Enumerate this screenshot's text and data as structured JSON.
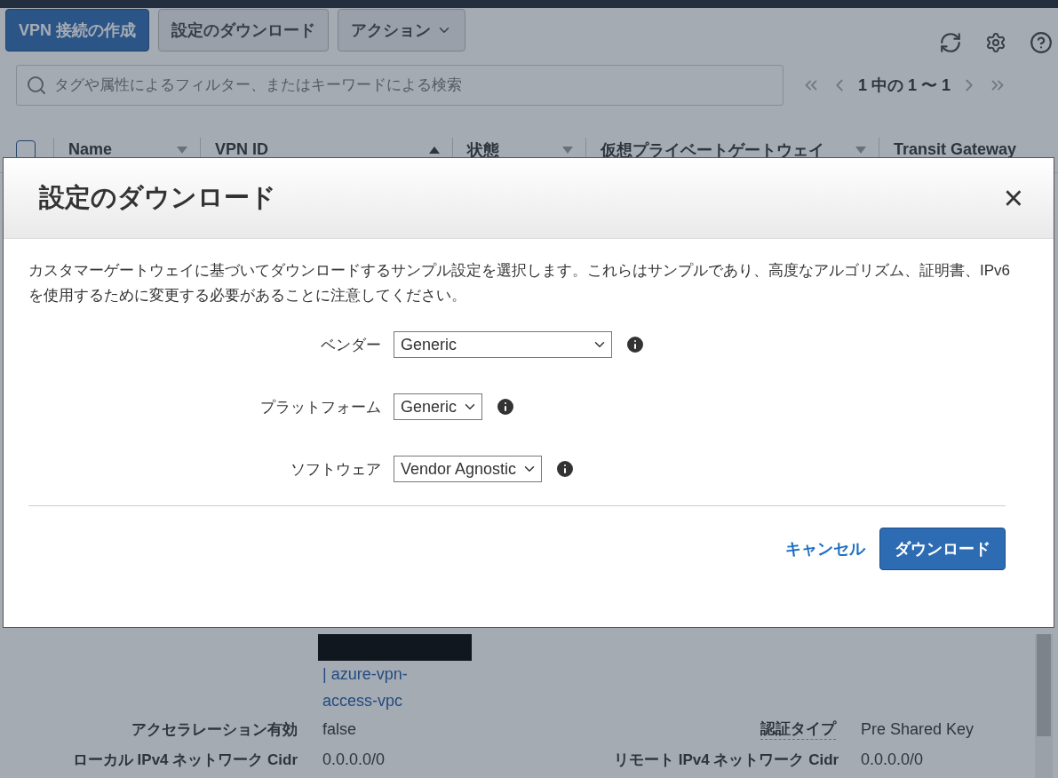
{
  "toolbar": {
    "buttons": [
      {
        "label": "VPN 接続の作成",
        "kind": "primary"
      },
      {
        "label": "設定のダウンロード",
        "kind": "plain"
      },
      {
        "label": "アクション",
        "kind": "menu"
      }
    ]
  },
  "search": {
    "placeholder": "タグや属性によるフィルター、またはキーワードによる検索"
  },
  "pagination": {
    "text": "1 中の 1 〜 1"
  },
  "table": {
    "select_all": {
      "checked": false
    },
    "columns": [
      {
        "label": "Name",
        "kind": "sortable"
      },
      {
        "label": "VPN ID",
        "kind": "sorted"
      },
      {
        "label": "状態",
        "kind": "sortable"
      },
      {
        "label": "仮想プライベートゲートウェイ",
        "kind": "sortable"
      },
      {
        "label": "Transit Gateway",
        "kind": "plain"
      }
    ]
  },
  "details": {
    "vpc_link": [
      "| azure-vpn-",
      "access-vpc"
    ],
    "rows": [
      {
        "label": "アクセラレーション有効",
        "value": "false",
        "label2": "認証タイプ",
        "value2": "Pre Shared Key"
      },
      {
        "label": "ローカル IPv4 ネットワーク Cidr",
        "value": "0.0.0.0/0",
        "label2": "リモート IPv4 ネットワーク Cidr",
        "value2": "0.0.0.0/0"
      }
    ]
  },
  "dialog": {
    "title": "設定のダウンロード",
    "close": "×",
    "description": "カスタマーゲートウェイに基づいてダウンロードするサンプル設定を選択します。これらはサンプルであり、高度なアルゴリズム、証明書、IPv6 を使用するために変更する必要があることに注意してください。",
    "fields": [
      {
        "label": "ベンダー",
        "value": "Generic"
      },
      {
        "label": "プラットフォーム",
        "value": "Generic"
      },
      {
        "label": "ソフトウェア",
        "value": "Vendor Agnostic"
      }
    ],
    "cancel": "キャンセル",
    "download": "ダウンロード"
  }
}
